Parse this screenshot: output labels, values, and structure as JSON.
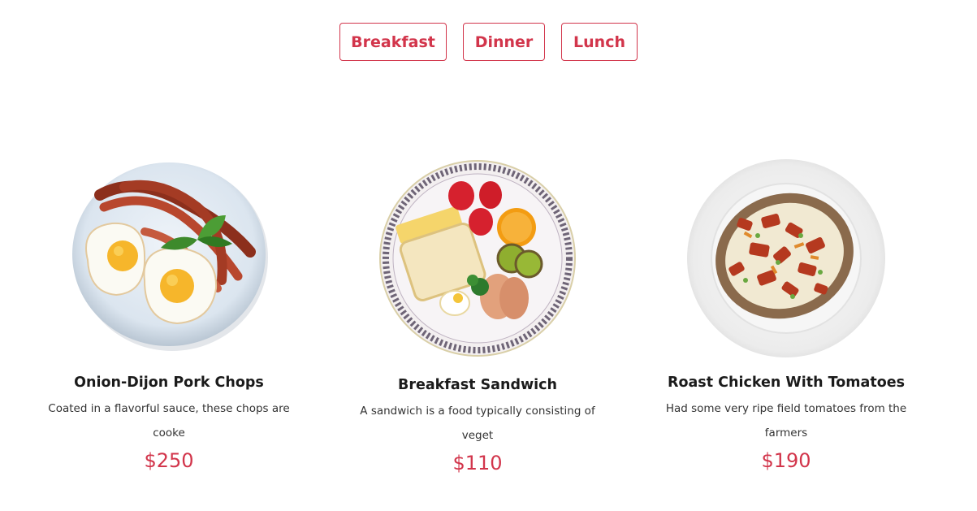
{
  "tabs": [
    {
      "label": "Breakfast"
    },
    {
      "label": "Dinner"
    },
    {
      "label": "Lunch"
    }
  ],
  "items": [
    {
      "title": "Onion-Dijon Pork Chops",
      "description": "Coated in a flavorful sauce, these chops are cooke",
      "price": "$250"
    },
    {
      "title": "Breakfast Sandwich",
      "description": "A sandwich is a food typically consisting of veget",
      "price": "$110"
    },
    {
      "title": "Roast Chicken With Tomatoes",
      "description": "Had some very ripe field tomatoes from the farmers",
      "price": "$190"
    }
  ],
  "colors": {
    "accent": "#d2354b",
    "title": "#1b1b1b",
    "text": "#333333"
  }
}
